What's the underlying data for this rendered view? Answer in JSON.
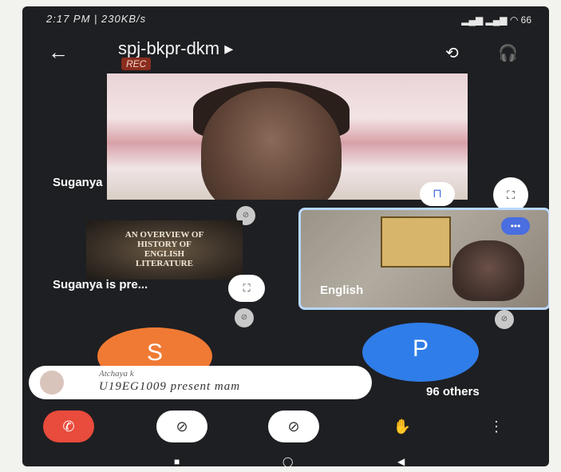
{
  "status_bar": {
    "left": "2:17 PM | 230KB/s",
    "right": "▂▄▆ ▂▄▆ ◠ 66"
  },
  "header": {
    "back_icon": "←",
    "meeting_code": "spj-bkpr-dkm ▸",
    "rec_badge": "REC",
    "switch_camera_icon": "⟲",
    "audio_icon": "🎧"
  },
  "main_video": {
    "name": "Suganya",
    "pin_icon": "⊓",
    "fullscreen_icon": "⛶"
  },
  "presentation": {
    "slide_lines": [
      "AN OVERVIEW OF",
      "HISTORY OF",
      "ENGLISH",
      "LITERATURE"
    ],
    "label": "Suganya is pre...",
    "fullscreen_icon": "⛶"
  },
  "participant_tile": {
    "name": "English",
    "more_icon": "•••"
  },
  "avatars": {
    "s_letter": "S",
    "p_letter": "P",
    "s_color": "#f07a34",
    "p_color": "#2f7de8"
  },
  "chat": {
    "sender": "Atchaya k",
    "message": "U19EG1009 present mam"
  },
  "others_label": "96 others",
  "controls": {
    "end_call_icon": "✆",
    "camera_off_icon": "⊘",
    "mic_off_icon": "⊘",
    "raise_hand_icon": "✋",
    "more_icon": "⋮",
    "end_call_color": "#e94b3c"
  },
  "nav": {
    "recents": "■",
    "home": "◯",
    "back": "◀"
  }
}
